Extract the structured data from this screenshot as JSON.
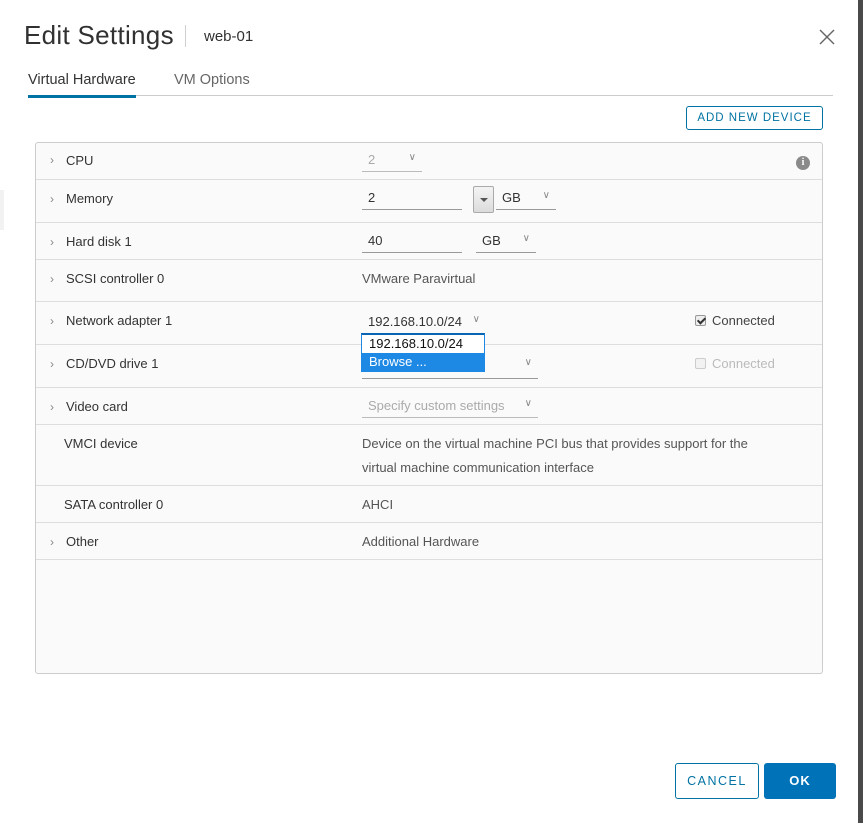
{
  "header": {
    "title": "Edit Settings",
    "subtitle": "web-01",
    "close_icon": "close-icon"
  },
  "tabs": [
    {
      "label": "Virtual Hardware",
      "active": true
    },
    {
      "label": "VM Options",
      "active": false
    }
  ],
  "toolbar": {
    "add_device_label": "ADD NEW DEVICE"
  },
  "hardware": {
    "cpu": {
      "label": "CPU",
      "value": "2",
      "info_icon": "info-icon"
    },
    "memory": {
      "label": "Memory",
      "value": "2",
      "unit": "GB"
    },
    "hard_disk": {
      "label": "Hard disk 1",
      "value": "40",
      "unit": "GB"
    },
    "scsi": {
      "label": "SCSI controller 0",
      "value": "VMware Paravirtual"
    },
    "network": {
      "label": "Network adapter 1",
      "value": "192.168.10.0/24",
      "connected_label": "Connected",
      "connected": true
    },
    "cdrom": {
      "label": "CD/DVD drive 1",
      "value": "",
      "connected_label": "Connected",
      "connected": false
    },
    "video": {
      "label": "Video card",
      "value": "Specify custom settings"
    },
    "vmci": {
      "label": "VMCI device",
      "value_line1": "Device on the virtual machine PCI bus that provides support for the",
      "value_line2": "virtual machine communication interface"
    },
    "sata": {
      "label": "SATA controller 0",
      "value": "AHCI"
    },
    "other": {
      "label": "Other",
      "value": "Additional Hardware"
    }
  },
  "network_dropdown": {
    "options": [
      "192.168.10.0/24",
      "Browse ..."
    ],
    "highlighted": "Browse ..."
  },
  "footer": {
    "cancel_label": "CANCEL",
    "ok_label": "OK"
  },
  "glyphs": {
    "chevron_right": "›",
    "chevron_down": "⌄",
    "caret": "∨",
    "info": "i"
  }
}
